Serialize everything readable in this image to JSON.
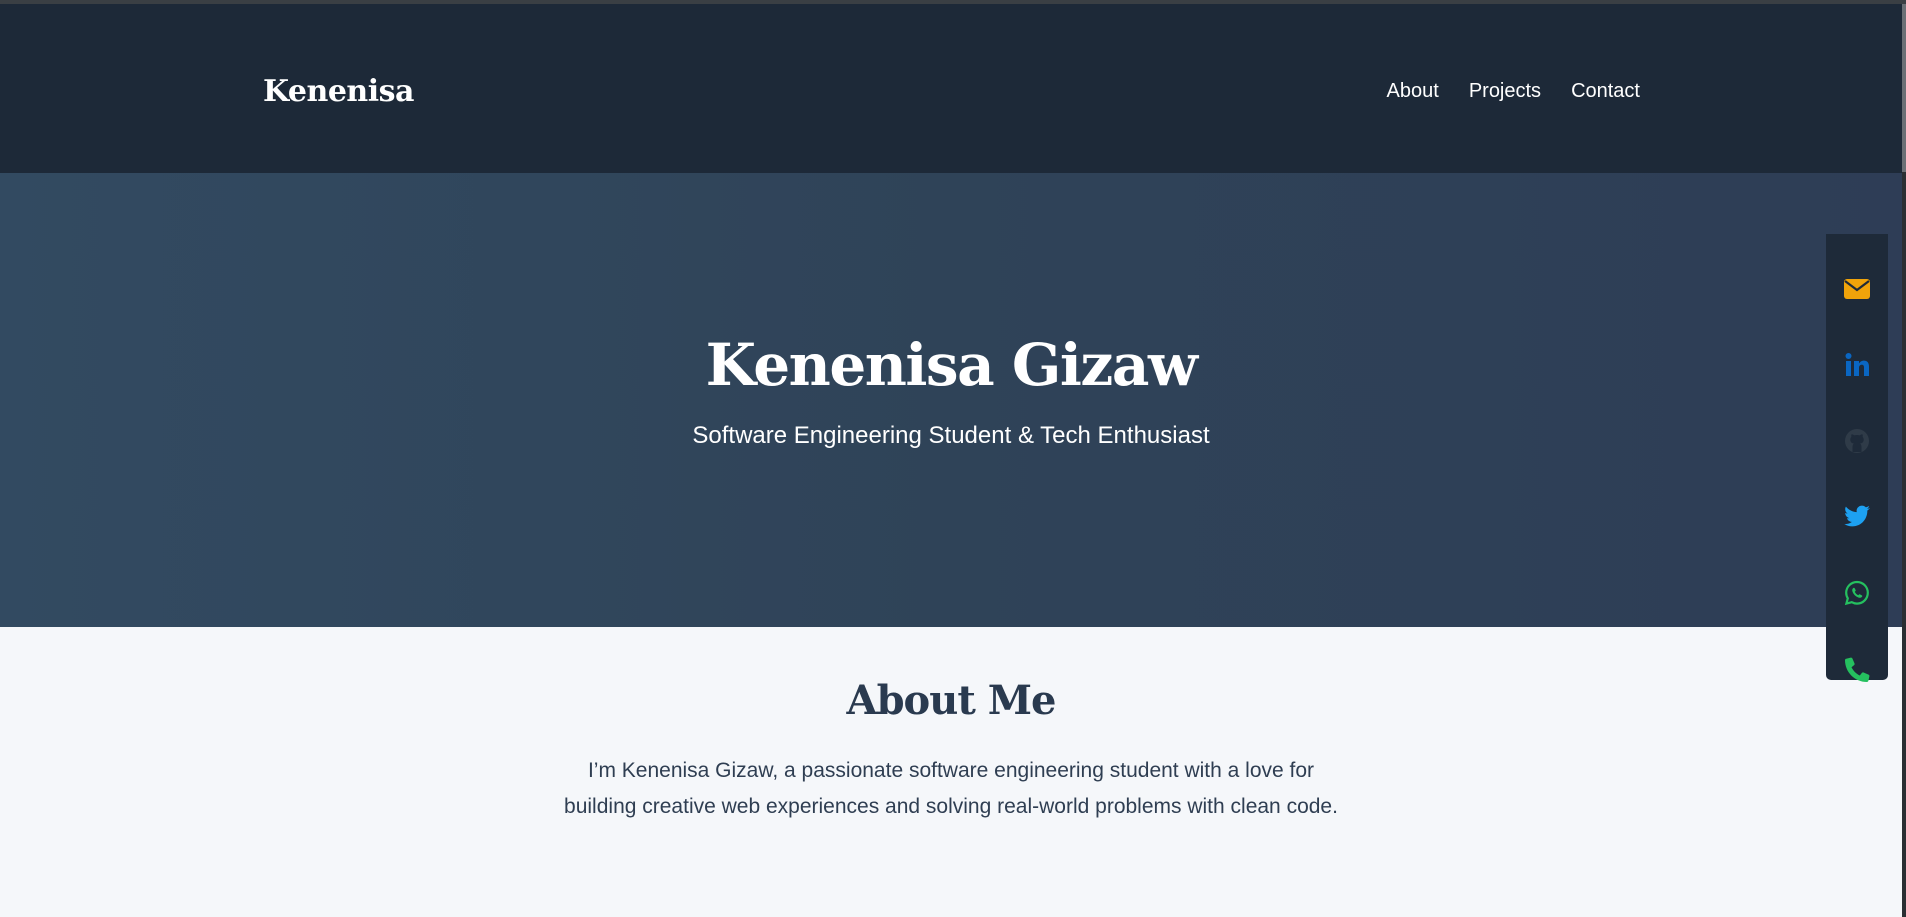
{
  "navbar": {
    "brand": "Kenenisa",
    "links": [
      {
        "label": "About"
      },
      {
        "label": "Projects"
      },
      {
        "label": "Contact"
      }
    ]
  },
  "hero": {
    "title": "Kenenisa Gizaw",
    "subtitle": "Software Engineering Student & Tech Enthusiast"
  },
  "about": {
    "title": "About Me",
    "text_line1": "I’m Kenenisa Gizaw, a passionate software engineering student with a love for",
    "text_line2": "building creative web experiences and solving real-world problems with clean code."
  },
  "social": {
    "items": [
      {
        "icon": "email-icon",
        "color": "#f0a30a"
      },
      {
        "icon": "linkedin-icon",
        "color": "#0a66c2"
      },
      {
        "icon": "github-icon",
        "color": "#2f3b48"
      },
      {
        "icon": "twitter-icon",
        "color": "#1da1f2"
      },
      {
        "icon": "whatsapp-icon",
        "color": "#25c05f"
      },
      {
        "icon": "phone-icon",
        "color": "#25c05f"
      }
    ]
  },
  "colors": {
    "navbar_bg": "#1d2938",
    "hero_bg": "#31465c",
    "about_bg": "#f5f7fa",
    "heading_text": "#2a3a4f"
  }
}
